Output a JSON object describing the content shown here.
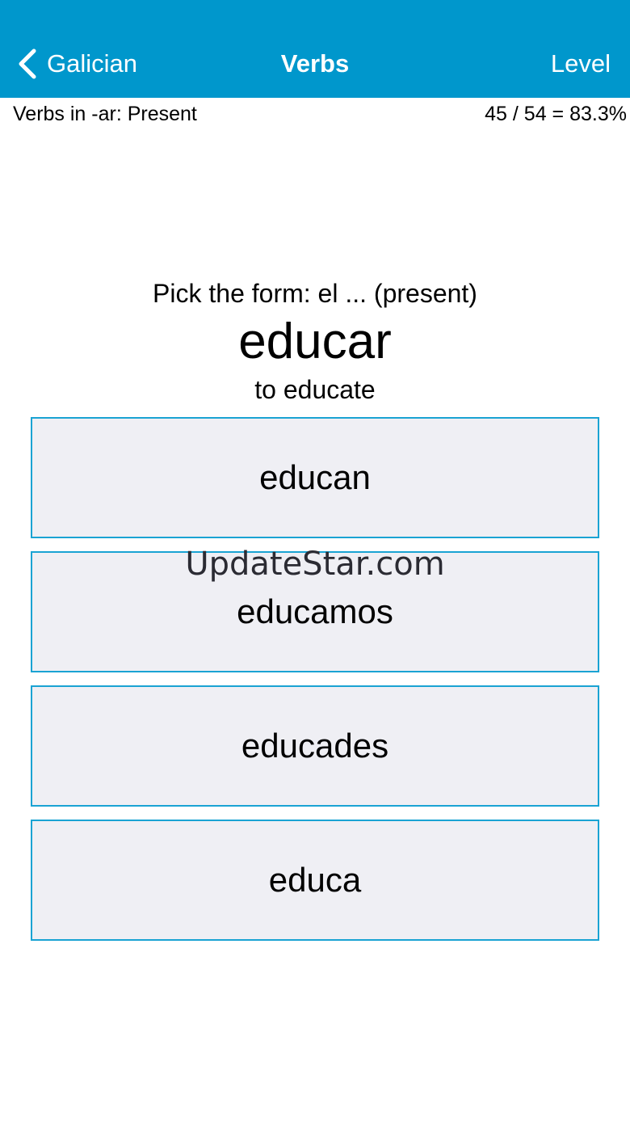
{
  "nav": {
    "back_label": "Galician",
    "title": "Verbs",
    "level_label": "Level"
  },
  "subheader": {
    "section": "Verbs in -ar: Present",
    "score": "45 / 54 = 83.3%"
  },
  "question": {
    "prompt": "Pick the form: el ... (present)",
    "verb": "educar",
    "translation": "to educate"
  },
  "answers": [
    {
      "label": "educan"
    },
    {
      "label": "educamos"
    },
    {
      "label": "educades"
    },
    {
      "label": "educa"
    }
  ],
  "watermark": "UpdateStar.com",
  "colors": {
    "nav_background": "#0097cc",
    "answer_border": "#1aa3d3",
    "answer_background": "#efeff4"
  },
  "icons": {
    "back": "chevron-left-icon"
  }
}
